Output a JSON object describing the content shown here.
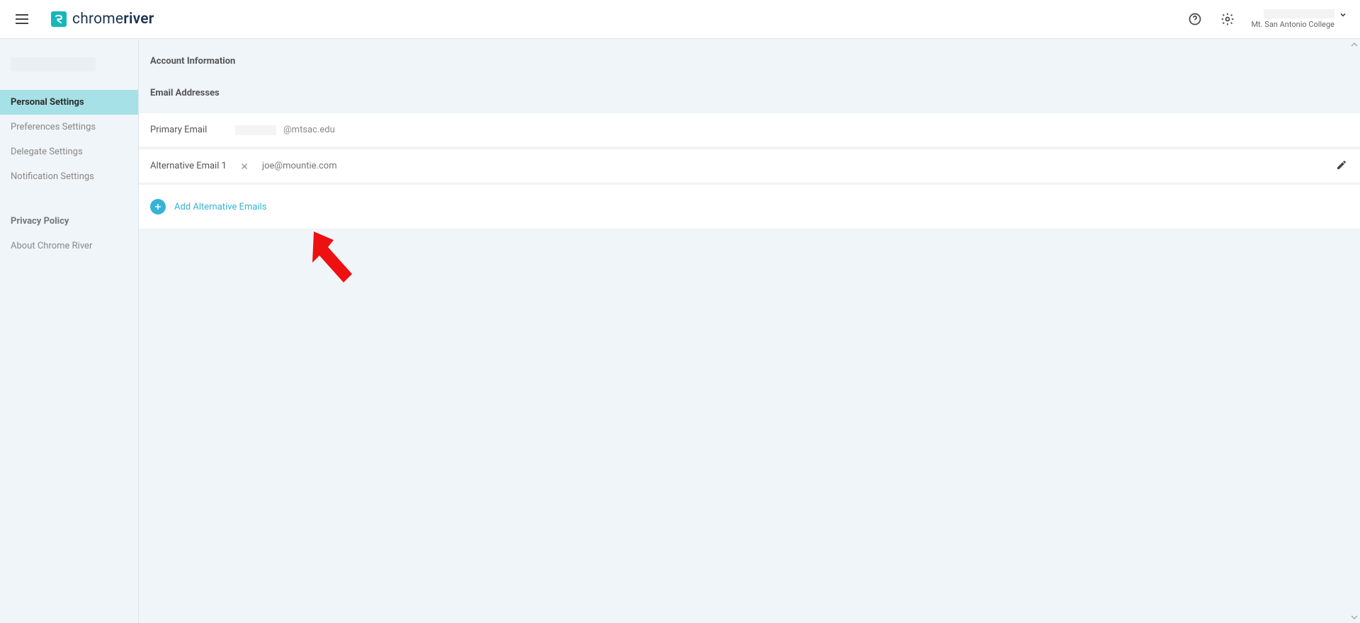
{
  "header": {
    "brand_prefix": "chrome",
    "brand_suffix": "river",
    "org": "Mt. San Antonio College"
  },
  "sidebar": {
    "items": [
      {
        "label": "Personal Settings",
        "active": true
      },
      {
        "label": "Preferences Settings",
        "active": false
      },
      {
        "label": "Delegate Settings",
        "active": false
      },
      {
        "label": "Notification Settings",
        "active": false
      }
    ],
    "privacy_heading": "Privacy Policy",
    "about_label": "About Chrome River"
  },
  "content": {
    "section_title": "Account Information",
    "email_heading": "Email Addresses",
    "primary_label": "Primary Email",
    "primary_domain": "@mtsac.edu",
    "alt_label": "Alternative Email 1",
    "alt_value": "joe@mountie.com",
    "add_label": "Add Alternative Emails"
  }
}
